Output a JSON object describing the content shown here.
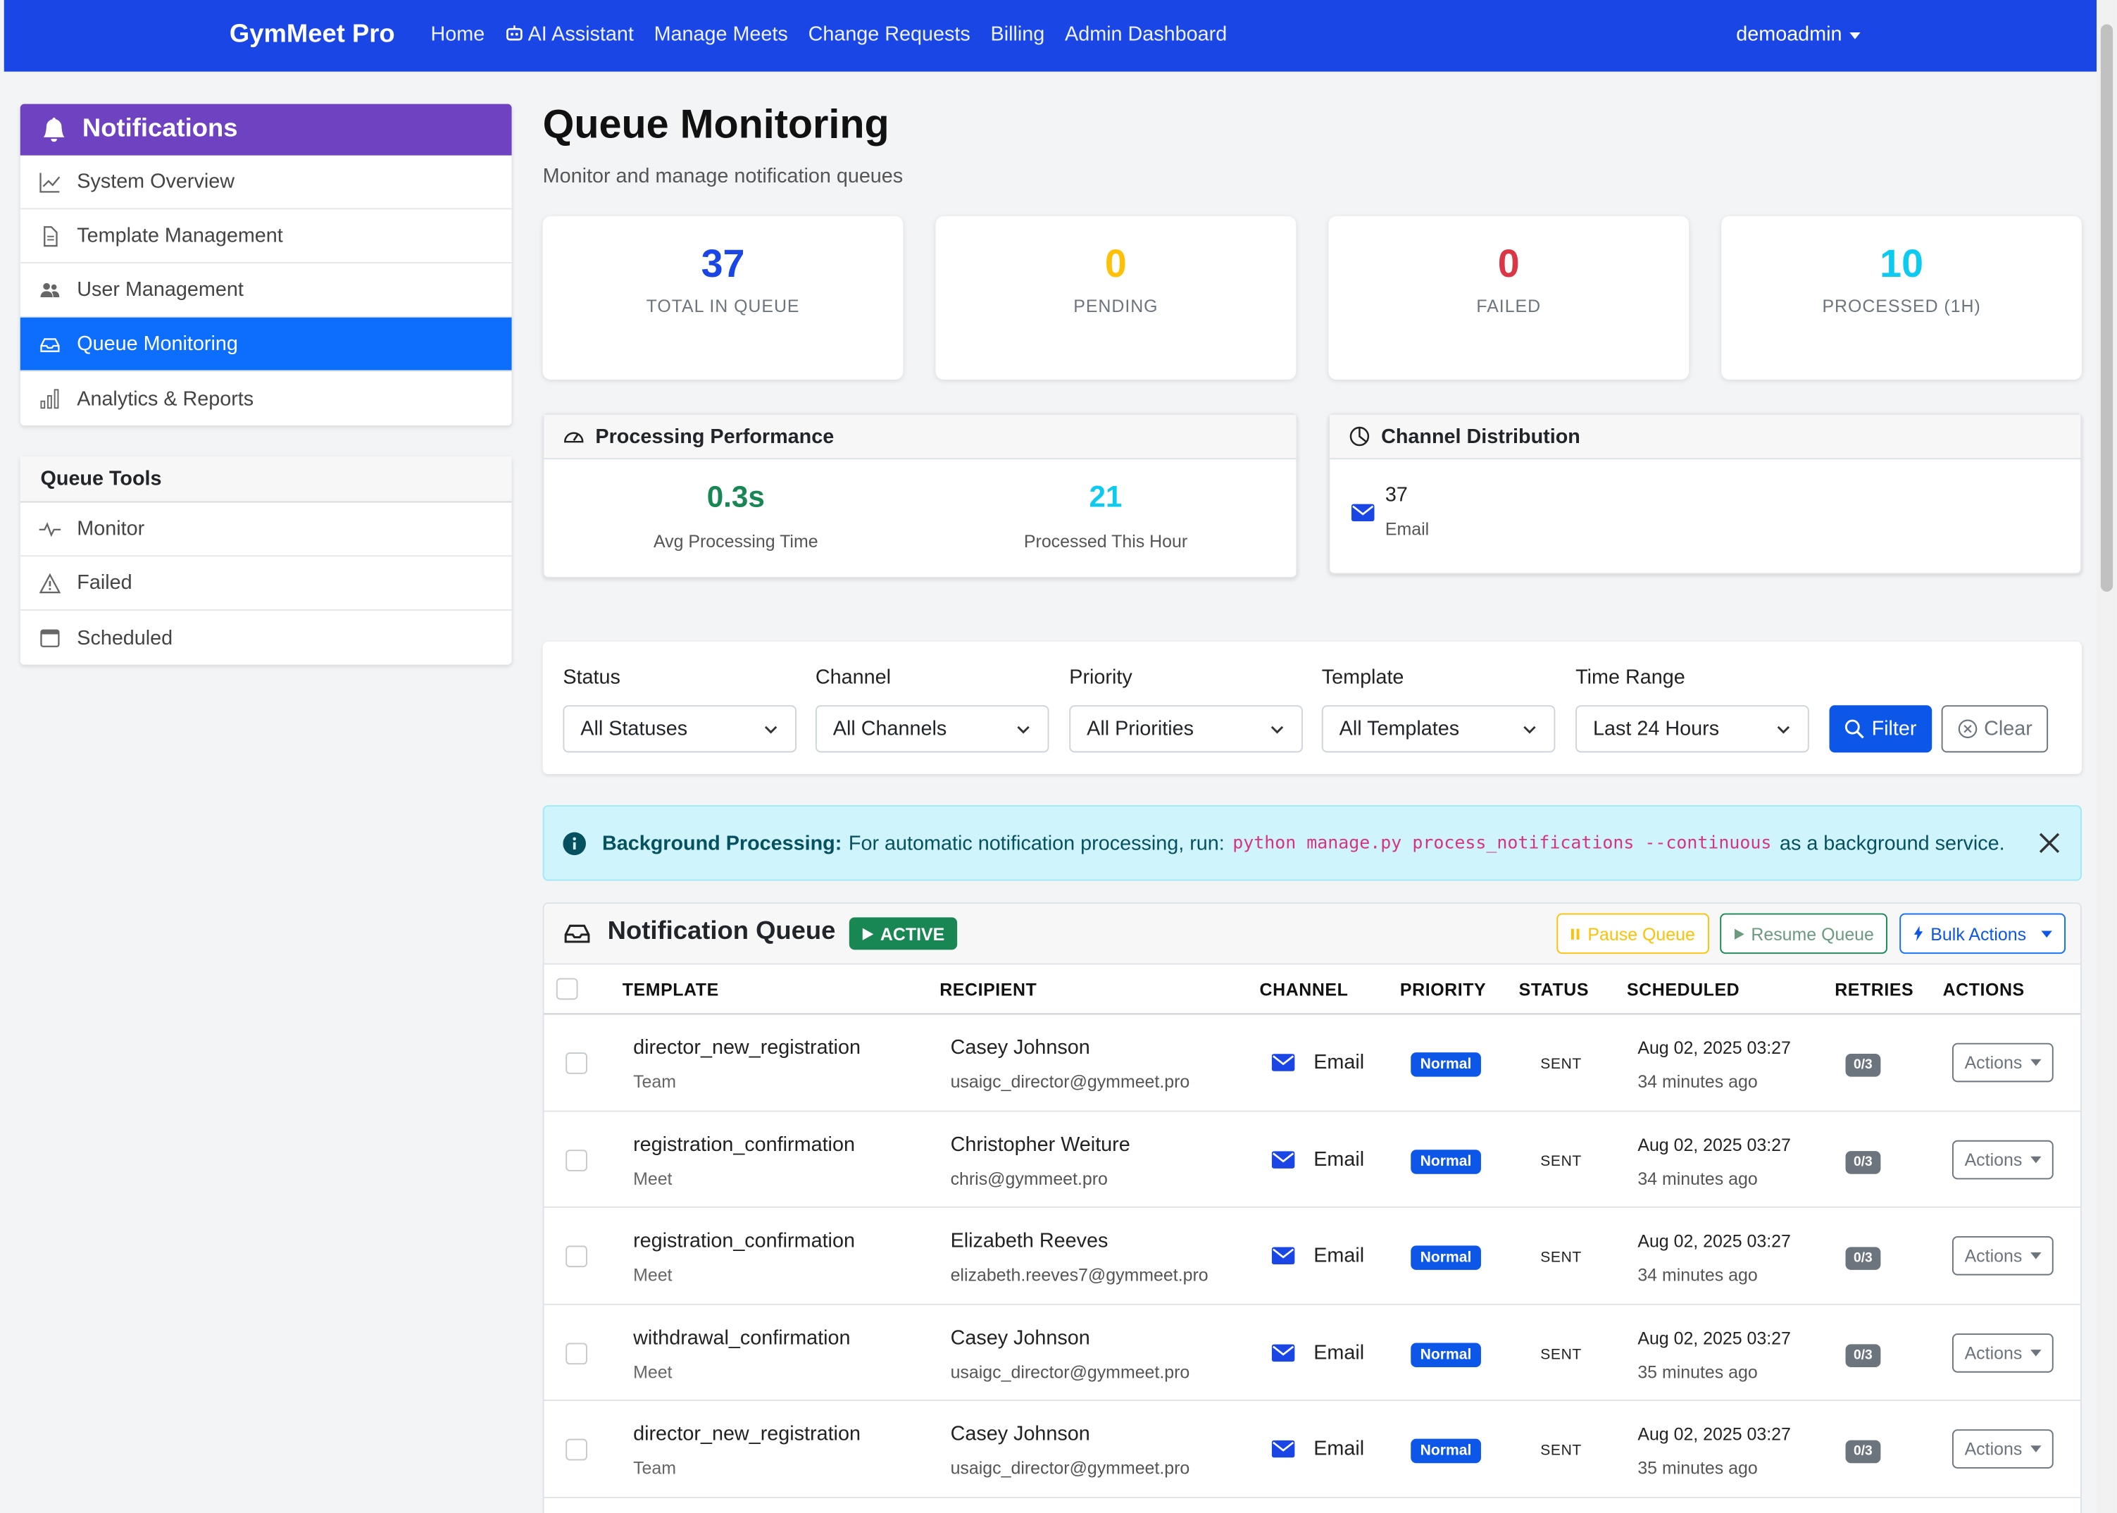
{
  "nav": {
    "brand": "GymMeet Pro",
    "links": [
      "Home",
      "AI Assistant",
      "Manage Meets",
      "Change Requests",
      "Billing",
      "Admin Dashboard"
    ],
    "user": "demoadmin"
  },
  "sidebar": {
    "header": "Notifications",
    "items": [
      {
        "label": "System Overview",
        "icon": "chart-line-icon"
      },
      {
        "label": "Template Management",
        "icon": "file-text-icon"
      },
      {
        "label": "User Management",
        "icon": "people-icon"
      },
      {
        "label": "Queue Monitoring",
        "icon": "inbox-icon",
        "active": true
      },
      {
        "label": "Analytics & Reports",
        "icon": "bar-chart-icon"
      }
    ],
    "tools_header": "Queue Tools",
    "tools": [
      {
        "label": "Monitor",
        "icon": "activity-icon"
      },
      {
        "label": "Failed",
        "icon": "warning-icon"
      },
      {
        "label": "Scheduled",
        "icon": "calendar-icon"
      }
    ]
  },
  "page": {
    "title": "Queue Monitoring",
    "subtitle": "Monitor and manage notification queues"
  },
  "stats": [
    {
      "value": "37",
      "label": "TOTAL IN QUEUE",
      "color": "#1a46e6"
    },
    {
      "value": "0",
      "label": "PENDING",
      "color": "#ffc107"
    },
    {
      "value": "0",
      "label": "FAILED",
      "color": "#dc3545"
    },
    {
      "value": "10",
      "label": "PROCESSED (1H)",
      "color": "#0dcaf0"
    }
  ],
  "performance": {
    "title": "Processing Performance",
    "avg_value": "0.3s",
    "avg_label": "Avg Processing Time",
    "hour_value": "21",
    "hour_label": "Processed This Hour"
  },
  "distribution": {
    "title": "Channel Distribution",
    "count": "37",
    "channel": "Email"
  },
  "filters": {
    "status_label": "Status",
    "status_value": "All Statuses",
    "channel_label": "Channel",
    "channel_value": "All Channels",
    "priority_label": "Priority",
    "priority_value": "All Priorities",
    "template_label": "Template",
    "template_value": "All Templates",
    "time_label": "Time Range",
    "time_value": "Last 24 Hours",
    "filter_btn": "Filter",
    "clear_btn": "Clear"
  },
  "alert": {
    "title": "Background Processing:",
    "text_before": "For automatic notification processing, run:",
    "code": "python manage.py process_notifications --continuous",
    "text_after": "as a background service."
  },
  "queue": {
    "title": "Notification Queue",
    "status_badge": "ACTIVE",
    "pause_btn": "Pause Queue",
    "resume_btn": "Resume Queue",
    "bulk_btn": "Bulk Actions",
    "columns": [
      "TEMPLATE",
      "RECIPIENT",
      "CHANNEL",
      "PRIORITY",
      "STATUS",
      "SCHEDULED",
      "RETRIES",
      "ACTIONS"
    ],
    "rows": [
      {
        "template": "director_new_registration",
        "type": "Team",
        "name": "Casey Johnson",
        "email": "usaigc_director@gymmeet.pro",
        "channel": "Email",
        "priority": "Normal",
        "status": "SENT",
        "scheduled": "Aug 02, 2025 03:27",
        "ago": "34 minutes ago",
        "retries": "0/3",
        "action": "Actions"
      },
      {
        "template": "registration_confirmation",
        "type": "Meet",
        "name": "Christopher Weiture",
        "email": "chris@gymmeet.pro",
        "channel": "Email",
        "priority": "Normal",
        "status": "SENT",
        "scheduled": "Aug 02, 2025 03:27",
        "ago": "34 minutes ago",
        "retries": "0/3",
        "action": "Actions"
      },
      {
        "template": "registration_confirmation",
        "type": "Meet",
        "name": "Elizabeth Reeves",
        "email": "elizabeth.reeves7@gymmeet.pro",
        "channel": "Email",
        "priority": "Normal",
        "status": "SENT",
        "scheduled": "Aug 02, 2025 03:27",
        "ago": "34 minutes ago",
        "retries": "0/3",
        "action": "Actions"
      },
      {
        "template": "withdrawal_confirmation",
        "type": "Meet",
        "name": "Casey Johnson",
        "email": "usaigc_director@gymmeet.pro",
        "channel": "Email",
        "priority": "Normal",
        "status": "SENT",
        "scheduled": "Aug 02, 2025 03:27",
        "ago": "35 minutes ago",
        "retries": "0/3",
        "action": "Actions"
      },
      {
        "template": "director_new_registration",
        "type": "Team",
        "name": "Casey Johnson",
        "email": "usaigc_director@gymmeet.pro",
        "channel": "Email",
        "priority": "Normal",
        "status": "SENT",
        "scheduled": "Aug 02, 2025 03:27",
        "ago": "35 minutes ago",
        "retries": "0/3",
        "action": "Actions"
      }
    ]
  }
}
